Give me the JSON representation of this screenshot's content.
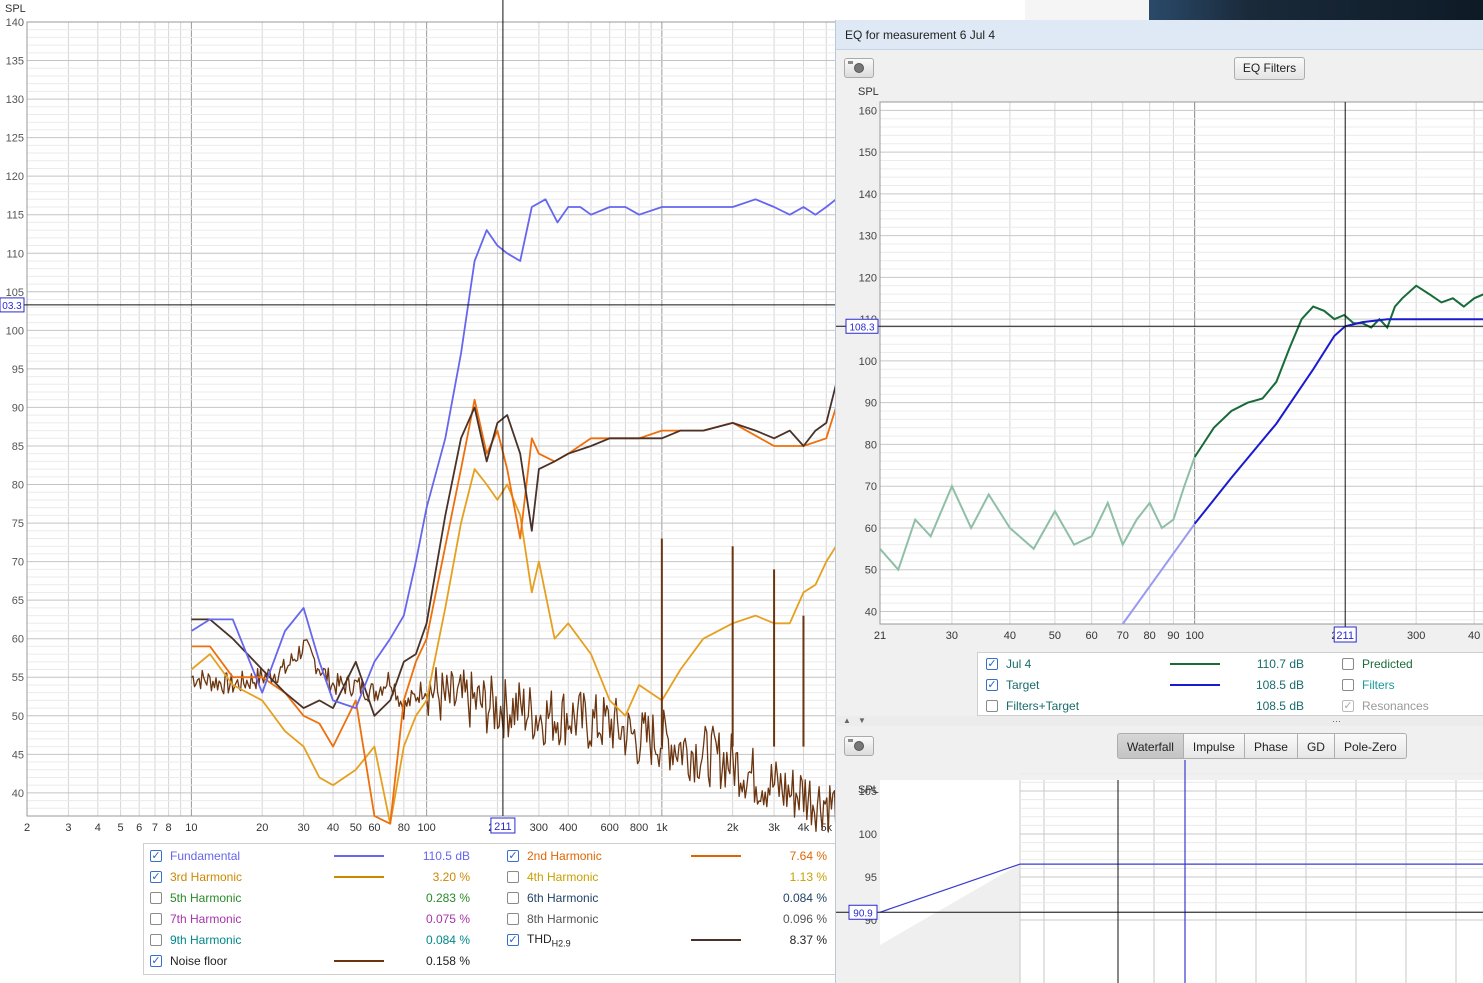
{
  "left_chart": {
    "y_label": "SPL",
    "y_ticks": [
      "140",
      "135",
      "130",
      "125",
      "120",
      "115",
      "110",
      "105",
      "100",
      "95",
      "90",
      "85",
      "80",
      "75",
      "70",
      "65",
      "60",
      "55",
      "50",
      "45",
      "40"
    ],
    "x_ticks": [
      "2",
      "3",
      "4",
      "5",
      "6",
      "7",
      "8",
      "10",
      "20",
      "30",
      "40",
      "50",
      "60",
      "80",
      "100",
      "200",
      "300",
      "400",
      "600",
      "800",
      "1k",
      "2k",
      "3k",
      "4k",
      "5k"
    ],
    "cursor_y_label": "03.3",
    "cursor_x_label": "211",
    "colors": {
      "fundamental": "#6666ee",
      "h2": "#ee6f0c",
      "h3": "#e6a020",
      "thd": "#4a3228",
      "noise": "#6b3510"
    }
  },
  "chart_data": [
    {
      "type": "line",
      "title": "",
      "ylabel": "SPL",
      "xlabel": "",
      "x_scale": "log",
      "xlim": [
        2,
        5500
      ],
      "ylim": [
        37,
        140
      ],
      "series": [
        {
          "name": "Fundamental",
          "x": [
            10,
            12,
            15,
            20,
            25,
            30,
            35,
            40,
            50,
            60,
            70,
            80,
            90,
            100,
            120,
            140,
            160,
            180,
            200,
            220,
            250,
            280,
            320,
            360,
            400,
            450,
            500,
            600,
            700,
            800,
            1000,
            1200,
            1500,
            2000,
            2500,
            3000,
            3500,
            4000,
            4500,
            5000,
            5500
          ],
          "y": [
            61,
            62.5,
            62.5,
            53,
            61,
            64,
            57,
            52,
            51,
            57,
            60,
            63,
            70,
            77,
            86,
            97,
            109,
            113,
            111,
            110,
            109,
            116,
            117,
            114,
            116,
            116,
            115,
            116,
            116,
            115,
            116,
            116,
            116,
            116,
            117,
            116,
            115,
            116,
            115,
            116,
            117
          ]
        },
        {
          "name": "2nd Harmonic",
          "x": [
            10,
            12,
            15,
            20,
            25,
            30,
            35,
            40,
            50,
            60,
            70,
            80,
            90,
            100,
            120,
            140,
            160,
            180,
            200,
            220,
            250,
            280,
            300,
            350,
            400,
            500,
            600,
            800,
            1000,
            1500,
            2000,
            3000,
            4000,
            5000,
            5500
          ],
          "y": [
            59,
            59,
            55,
            55,
            53,
            50,
            49,
            46,
            52,
            37,
            36,
            52,
            57,
            60,
            72,
            82,
            91,
            84,
            87,
            82,
            73,
            86,
            84,
            83,
            84,
            86,
            86,
            86,
            87,
            87,
            88,
            85,
            85,
            86,
            90
          ]
        },
        {
          "name": "3rd Harmonic",
          "x": [
            10,
            12,
            15,
            20,
            25,
            30,
            35,
            40,
            50,
            60,
            70,
            80,
            90,
            100,
            120,
            140,
            160,
            180,
            200,
            220,
            250,
            280,
            300,
            350,
            400,
            500,
            600,
            700,
            800,
            1000,
            1200,
            1500,
            2000,
            2500,
            3000,
            3500,
            4000,
            4500,
            5000,
            5500
          ],
          "y": [
            56,
            58,
            54,
            52,
            48,
            46,
            42,
            41,
            43,
            46,
            36,
            46,
            50,
            52,
            64,
            75,
            82,
            80,
            78,
            80,
            76,
            66,
            70,
            60,
            62,
            58,
            52,
            50,
            54,
            52,
            56,
            60,
            62,
            63,
            62,
            62,
            66,
            67,
            70,
            72
          ]
        },
        {
          "name": "THD",
          "x": [
            10,
            12,
            15,
            20,
            25,
            30,
            35,
            40,
            50,
            60,
            70,
            80,
            90,
            100,
            120,
            140,
            160,
            180,
            200,
            220,
            250,
            280,
            300,
            350,
            400,
            500,
            600,
            800,
            1000,
            1200,
            1500,
            2000,
            2500,
            3000,
            3500,
            4000,
            4500,
            5000,
            5500
          ],
          "y": [
            62.5,
            62.5,
            60,
            56,
            53,
            51,
            52,
            51,
            57,
            50,
            52,
            57,
            58,
            62,
            76,
            86,
            90,
            83,
            88,
            89,
            84,
            74,
            82,
            83,
            84,
            85,
            86,
            86,
            86,
            87,
            87,
            88,
            87,
            86,
            87,
            85,
            87,
            88,
            93
          ]
        },
        {
          "name": "Noise floor",
          "x": [
            10,
            15,
            20,
            25,
            30,
            40,
            50,
            60,
            70,
            80,
            100,
            120,
            150,
            200,
            250,
            300,
            400,
            500,
            600,
            800,
            1000,
            1200,
            1500,
            2000,
            2500,
            3000,
            3500,
            4000,
            4500,
            5000,
            5500
          ],
          "y": [
            55,
            54,
            55,
            56,
            59,
            54,
            54,
            53,
            55,
            51,
            54,
            52,
            52,
            51,
            51,
            50,
            50,
            49,
            49,
            47,
            47,
            46,
            45,
            44,
            42,
            41,
            40,
            40,
            39,
            39,
            38
          ]
        }
      ]
    },
    {
      "type": "line",
      "title": "",
      "ylabel": "SPL",
      "xlabel": "",
      "x_scale": "log",
      "xlim": [
        21,
        420
      ],
      "ylim": [
        37,
        162
      ],
      "series": [
        {
          "name": "Jul 4",
          "x": [
            21,
            23,
            25,
            27,
            30,
            33,
            36,
            40,
            45,
            50,
            55,
            60,
            65,
            70,
            75,
            80,
            85,
            90,
            95,
            100,
            110,
            120,
            130,
            140,
            150,
            160,
            170,
            180,
            190,
            200,
            210,
            220,
            230,
            240,
            250,
            260,
            270,
            280,
            300,
            320,
            340,
            360,
            380,
            400,
            420
          ],
          "y": [
            55,
            50,
            62,
            58,
            70,
            60,
            68,
            60,
            55,
            64,
            56,
            58,
            66,
            56,
            62,
            66,
            60,
            62,
            70,
            77,
            84,
            88,
            90,
            91,
            95,
            103,
            110,
            113,
            112,
            110,
            111,
            109,
            109,
            108,
            110,
            108,
            113,
            115,
            118,
            116,
            114,
            115,
            113,
            115,
            116
          ]
        },
        {
          "name": "Target",
          "x": [
            70,
            100,
            120,
            150,
            180,
            200,
            211,
            230,
            260,
            300,
            420
          ],
          "y": [
            37,
            61,
            72,
            85,
            98,
            106,
            108.3,
            109.3,
            110,
            110,
            110
          ]
        }
      ]
    }
  ],
  "legend_left": {
    "rows": [
      [
        {
          "label": "Fundamental",
          "checked": true,
          "value": "110.5 dB",
          "color": "#6666ee",
          "line": true
        },
        {
          "label": "2nd Harmonic",
          "checked": true,
          "value": "7.64 %",
          "color": "#dd6600",
          "line": true
        }
      ],
      [
        {
          "label": "3rd Harmonic",
          "checked": true,
          "value": "3.20 %",
          "color": "#cc8800",
          "line": true
        },
        {
          "label": "4th Harmonic",
          "checked": false,
          "value": "1.13 %",
          "color": "#c8a000",
          "line": false
        }
      ],
      [
        {
          "label": "5th Harmonic",
          "checked": false,
          "value": "0.283 %",
          "color": "#2a8a2a",
          "line": false
        },
        {
          "label": "6th Harmonic",
          "checked": false,
          "value": "0.084 %",
          "color": "#224466",
          "line": false
        }
      ],
      [
        {
          "label": "7th Harmonic",
          "checked": false,
          "value": "0.075 %",
          "color": "#aa33aa",
          "line": false
        },
        {
          "label": "8th Harmonic",
          "checked": false,
          "value": "0.096 %",
          "color": "#555555",
          "line": false
        }
      ],
      [
        {
          "label": "9th Harmonic",
          "checked": false,
          "value": "0.084 %",
          "color": "#008888",
          "line": false
        },
        {
          "label": "THD",
          "sub": "H2.9",
          "checked": true,
          "value": "8.37 %",
          "color": "#222222",
          "line": true,
          "line_color": "#4a3228"
        }
      ],
      [
        {
          "label": "Noise floor",
          "checked": true,
          "value": "0.158 %",
          "color": "#222222",
          "line": true,
          "line_color": "#6b3510"
        }
      ]
    ]
  },
  "eq_window": {
    "title": "EQ for measurement 6 Jul 4",
    "eq_filters_button": "EQ Filters",
    "chart": {
      "y_label": "SPL",
      "y_ticks": [
        "160",
        "150",
        "140",
        "130",
        "120",
        "110",
        "100",
        "90",
        "80",
        "70",
        "60",
        "50",
        "40"
      ],
      "x_ticks": [
        "21",
        "30",
        "40",
        "50",
        "60",
        "70",
        "80",
        "90",
        "100",
        "2",
        "300",
        "40"
      ],
      "cursor_y_label": "108.3",
      "cursor_x_label": "211",
      "colors": {
        "jul4": "#1a6b3a",
        "jul4_light": "#8fbfa6",
        "target": "#1a1ad0",
        "target_light": "#9a9af0"
      }
    },
    "legend": {
      "items": [
        {
          "label": "Jul 4",
          "checked": true,
          "value": "110.7 dB",
          "line_color": "#1a6b3a"
        },
        {
          "label": "Target",
          "checked": true,
          "value": "108.5 dB",
          "line_color": "#1a1ad0"
        },
        {
          "label": "Filters+Target",
          "checked": false,
          "value": "108.5 dB"
        }
      ],
      "right_items": [
        {
          "label": "Predicted",
          "checked": false,
          "color": "#1a6b3a"
        },
        {
          "label": "Filters",
          "checked": false,
          "color": "#1a9a9a"
        },
        {
          "label": "Resonances",
          "checked": true,
          "color": "#999999"
        }
      ],
      "label_color": "#1a6b6b"
    },
    "tabs": [
      "Waterfall",
      "Impulse",
      "Phase",
      "GD",
      "Pole-Zero"
    ],
    "active_tab": "Waterfall",
    "bottom_chart": {
      "y_label": "SPL",
      "y_ticks": [
        "105",
        "100",
        "95",
        "90"
      ],
      "cursor_y_label": "90.9"
    }
  }
}
